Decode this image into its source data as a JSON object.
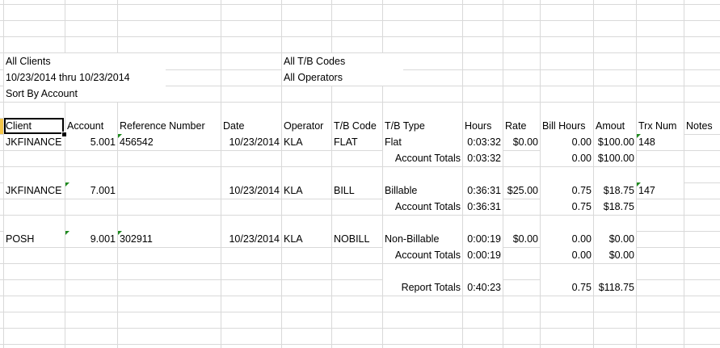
{
  "report_header": {
    "clients": "All Clients",
    "date_range": "10/23/2014 thru 10/23/2014",
    "sort": "Sort By Account",
    "tb_codes": "All T/B Codes",
    "operators": "All Operators"
  },
  "columns": {
    "client": "Client",
    "account": "Account",
    "reference_number": "Reference Number",
    "date": "Date",
    "operator": "Operator",
    "tb_code": "T/B Code",
    "tb_type": "T/B Type",
    "hours": "Hours",
    "rate": "Rate",
    "bill_hours": "Bill Hours",
    "amount": "Amout",
    "trx_num": "Trx Num",
    "notes": "Notes"
  },
  "rows": [
    {
      "client": "JKFINANCE",
      "account": "5.001",
      "reference_number": "456542",
      "date": "10/23/2014",
      "operator": "KLA",
      "tb_code": "FLAT",
      "tb_type": "Flat",
      "hours": "0:03:32",
      "rate": "$0.00",
      "bill_hours": "0.00",
      "amount": "$100.00",
      "trx_num": "148",
      "totals_label": "Account Totals",
      "totals_hours": "0:03:32",
      "totals_bill_hours": "0.00",
      "totals_amount": "$100.00"
    },
    {
      "client": "JKFINANCE",
      "account": "7.001",
      "reference_number": "",
      "date": "10/23/2014",
      "operator": "KLA",
      "tb_code": "BILL",
      "tb_type": "Billable",
      "hours": "0:36:31",
      "rate": "$25.00",
      "bill_hours": "0.75",
      "amount": "$18.75",
      "trx_num": "147",
      "totals_label": "Account Totals",
      "totals_hours": "0:36:31",
      "totals_bill_hours": "0.75",
      "totals_amount": "$18.75"
    },
    {
      "client": "POSH",
      "account": "9.001",
      "reference_number": "302911",
      "date": "10/23/2014",
      "operator": "KLA",
      "tb_code": "NOBILL",
      "tb_type": "Non-Billable",
      "hours": "0:00:19",
      "rate": "$0.00",
      "bill_hours": "0.00",
      "amount": "$0.00",
      "trx_num": "",
      "totals_label": "Account Totals",
      "totals_hours": "0:00:19",
      "totals_bill_hours": "0.00",
      "totals_amount": "$0.00"
    }
  ],
  "report_totals": {
    "label": "Report Totals",
    "hours": "0:40:23",
    "bill_hours": "0.75",
    "amount": "$118.75"
  }
}
